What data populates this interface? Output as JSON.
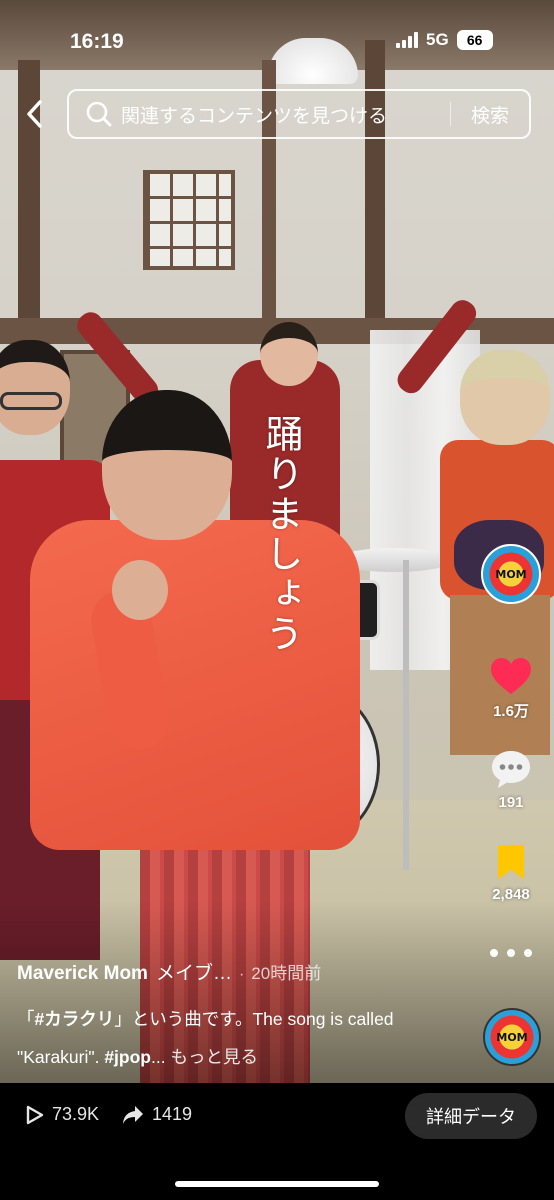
{
  "status_bar": {
    "time": "16:19",
    "network": "5G",
    "battery": "66"
  },
  "search": {
    "placeholder": "関連するコンテンツを見つける",
    "button": "検索"
  },
  "video": {
    "lyric_overlay": "踊りましょう"
  },
  "rail": {
    "likes": "1.6万",
    "comments": "191",
    "saves": "2,848",
    "avatar_text": "MOM"
  },
  "post": {
    "author": "Maverick Mom",
    "author_suffix": "メイブ…",
    "separator": "·",
    "time_ago": "20時間前",
    "caption_parts": {
      "open": "「",
      "hashtag1": "#カラクリ",
      "mid": "」という曲です。The song is called \"Karakuri\". ",
      "hashtag2": "#jpop",
      "ellipsis": "...",
      "more": "もっと見る"
    }
  },
  "bottom": {
    "views": "73.9K",
    "shares": "1419",
    "detail_button": "詳細データ"
  },
  "colors": {
    "like": "#fe2c55",
    "save": "#ffc700",
    "accent_blue": "#2aa0d8"
  }
}
